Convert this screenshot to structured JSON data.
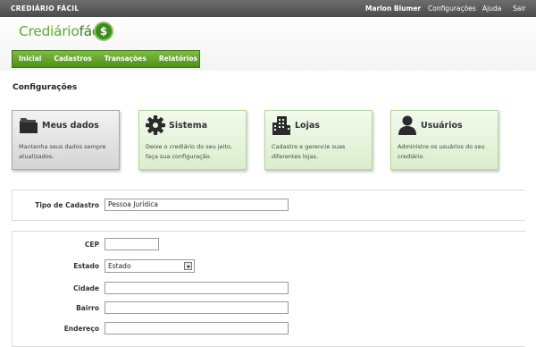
{
  "topbar": {
    "brand": "CREDIÁRIO FÁCIL",
    "user": "Marlon Blumer",
    "links": [
      "Configurações",
      "Ajuda",
      "Sair"
    ]
  },
  "logo": {
    "part1": "Crediário",
    "part2": "fácil",
    "symbol": "$"
  },
  "nav": [
    "Inicial",
    "Cadastros",
    "Transações",
    "Relatórios"
  ],
  "page_title": "Configurações",
  "cards": [
    {
      "title": "Meus dados",
      "desc": "Mantenha seus dados sempre atualizados.",
      "icon": "folder-icon",
      "active": true
    },
    {
      "title": "Sistema",
      "desc": "Deixe o crediário do seu jeito, faça sua configuração.",
      "icon": "gear-icon",
      "active": false
    },
    {
      "title": "Lojas",
      "desc": "Cadastre e gerencie suas diferentes lojas.",
      "icon": "building-icon",
      "active": false
    },
    {
      "title": "Usuários",
      "desc": "Administre os usuários do seu crediário.",
      "icon": "user-icon",
      "active": false
    }
  ],
  "form": {
    "tipo_label": "Tipo de Cadastro",
    "tipo_value": "Pessoa Jurídica",
    "cep_label": "CEP",
    "cep_value": "",
    "estado_label": "Estado",
    "estado_value": "Estado",
    "cidade_label": "Cidade",
    "bairro_label": "Bairro",
    "endereco_label": "Endereço"
  },
  "colors": {
    "nav_green": "#5fa12a",
    "card_green": "#dbeecc",
    "topbar": "#555555"
  }
}
